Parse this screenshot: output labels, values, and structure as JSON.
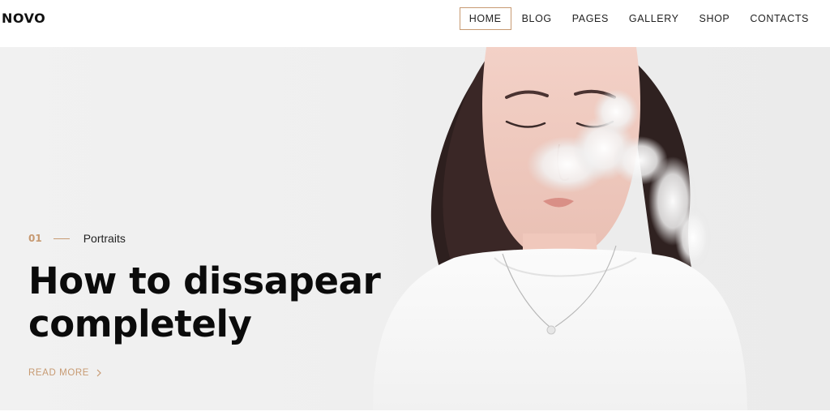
{
  "brand": {
    "logo": "NOVO"
  },
  "nav": {
    "items": [
      "HOME",
      "BLOG",
      "PAGES",
      "GALLERY",
      "SHOP",
      "CONTACTS"
    ],
    "active": "HOME"
  },
  "hero": {
    "number": "01",
    "category": "Portraits",
    "title": "How to dissapear completely",
    "cta": "READ MORE",
    "image": "portrait-woman-exhaling-smoke"
  },
  "colors": {
    "accent": "#c79a72",
    "text": "#0b0b0b",
    "hero_bg": "#eeeeee"
  }
}
